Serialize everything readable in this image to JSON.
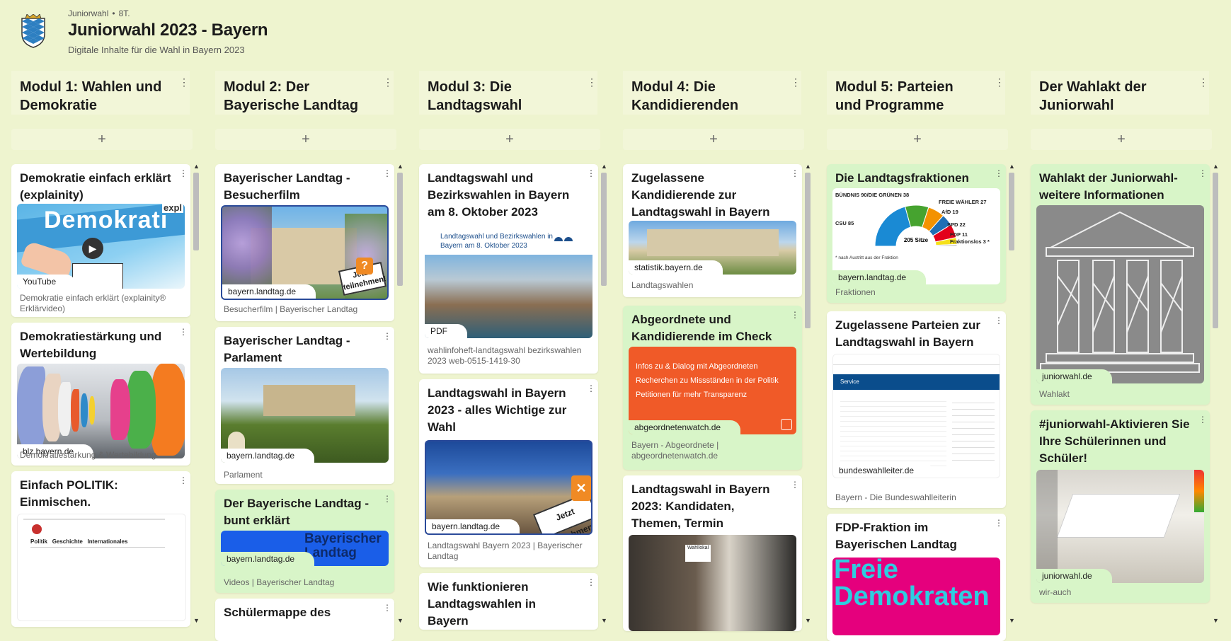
{
  "header": {
    "meta_name": "Juniorwahl",
    "meta_age": "8T.",
    "title": "Juniorwahl 2023 - Bayern",
    "subtitle": "Digitale Inhalte für die Wahl in Bayern 2023"
  },
  "columns": [
    {
      "title": "Modul 1: Wahlen und Demokratie"
    },
    {
      "title": "Modul 2: Der Bayerische Landtag"
    },
    {
      "title": "Modul 3: Die Landtagswahl"
    },
    {
      "title": "Modul 4: Die Kandidierenden"
    },
    {
      "title": "Modul 5: Parteien und Programme"
    },
    {
      "title": "Der Wahlakt der Juniorwahl"
    }
  ],
  "add_label": "+",
  "cards": {
    "c1a": {
      "title": "Demokratie einfach erklärt (explainity)",
      "source": "YouTube",
      "caption": "Demokratie einfach erklärt (explainity® Erklärvideo)",
      "img_text": "Demokrati",
      "img_corner": "expl"
    },
    "c1b": {
      "title": "Demokratiestärkung und Wertebildung",
      "source": "blz.bayern.de",
      "caption": "Demokratiestärkung & Wertebildung"
    },
    "c1c": {
      "title": "Einfach POLITIK: Einmischen. Mitentscheiden",
      "nav1": "Politik",
      "nav2": "Geschichte",
      "nav3": "Internationales"
    },
    "c2a": {
      "title": "Bayerischer Landtag - Besucherfilm",
      "source": "bayern.landtag.de",
      "caption": "Besucherfilm | Bayerischer Landtag",
      "badge": "Jetzt teilnehmen!"
    },
    "c2b": {
      "title": "Bayerischer Landtag - Parlament",
      "source": "bayern.landtag.de",
      "caption": "Parlament"
    },
    "c2c": {
      "title": "Der Bayerische Landtag - bunt erklärt",
      "source": "bayern.landtag.de",
      "caption": "Videos | Bayerischer Landtag",
      "img_text": "Bayerischer Landtag"
    },
    "c2d": {
      "title": "Schülermappe des"
    },
    "c3a": {
      "title": "Landtagswahl und Bezirkswahlen in Bayern am 8. Oktober 2023",
      "img_text": "Landtagswahl und Bezirkswahlen in Bayern am 8. Oktober 2023",
      "source": "PDF",
      "caption": "wahlinfoheft-landtagswahl bezirkswahlen 2023 web-0515-1419-30"
    },
    "c3b": {
      "title": "Landtagswahl in Bayern 2023 - alles Wichtige zur Wahl",
      "source": "bayern.landtag.de",
      "caption": "Landtagswahl Bayern 2023 | Bayerischer Landtag",
      "badge": "Jetzt teilnehmen!"
    },
    "c3c": {
      "title": "Wie funktionieren Landtagswahlen in Bayern"
    },
    "c4a": {
      "title": "Zugelassene Kandidierende zur Landtagswahl in Bayern",
      "source": "statistik.bayern.de",
      "caption": "Landtagswahlen"
    },
    "c4b": {
      "title": "Abgeordnete und Kandidierende im Check",
      "source": "abgeordnetenwatch.de",
      "caption": "Bayern - Abgeordnete | abgeordnetenwatch.de",
      "line1": "Infos zu & Dialog mit Abgeordneten",
      "line2": "Recherchen zu Missständen in der Politik",
      "line3": "Petitionen für mehr Transparenz"
    },
    "c4c": {
      "title": "Landtagswahl in Bayern 2023: Kandidaten, Themen, Termin",
      "img_text": "Wahllokal"
    },
    "c5a": {
      "title": "Die Landtagsfraktionen",
      "source": "bayern.landtag.de",
      "caption": "Fraktionen",
      "seats": "205 Sitze",
      "note": "* nach Austritt aus der Fraktion"
    },
    "c5b": {
      "title": "Zugelassene Parteien zur Landtagswahl in Bayern",
      "source": "bundeswahlleiter.de",
      "caption": "Bayern - Die Bundeswahlleiterin",
      "img_text": "Service"
    },
    "c5c": {
      "title": "FDP-Fraktion im Bayerischen Landtag",
      "img_text": "Freie Demokraten"
    },
    "c6a": {
      "title": "Wahlakt der Juniorwahl- weitere Informationen",
      "source": "juniorwahl.de",
      "caption": "Wahlakt"
    },
    "c6b": {
      "title": "#juniorwahl-Aktivieren Sie Ihre Schülerinnen und Schüler!",
      "source": "juniorwahl.de",
      "caption": "wir-auch"
    }
  },
  "chart_data": {
    "type": "pie",
    "title": "",
    "total_label": "205 Sitze",
    "series": [
      {
        "name": "CSU",
        "value": 85,
        "color": "#1a8ad4"
      },
      {
        "name": "BÜNDNIS 90/DIE GRÜNEN",
        "value": 38,
        "color": "#46a32f"
      },
      {
        "name": "FREIE WÄHLER",
        "value": 27,
        "color": "#f39200"
      },
      {
        "name": "AfD",
        "value": 19,
        "color": "#1f6fb5"
      },
      {
        "name": "SPD",
        "value": 22,
        "color": "#e3001b"
      },
      {
        "name": "FDP",
        "value": 11,
        "color": "#f5e01a"
      },
      {
        "name": "Fraktionslos",
        "value": 3,
        "color": "#c9c9c9"
      }
    ]
  },
  "colors": {
    "background": "#eef4cf",
    "green_card": "#d8f5c8",
    "column_head": "#f2f6d8"
  }
}
